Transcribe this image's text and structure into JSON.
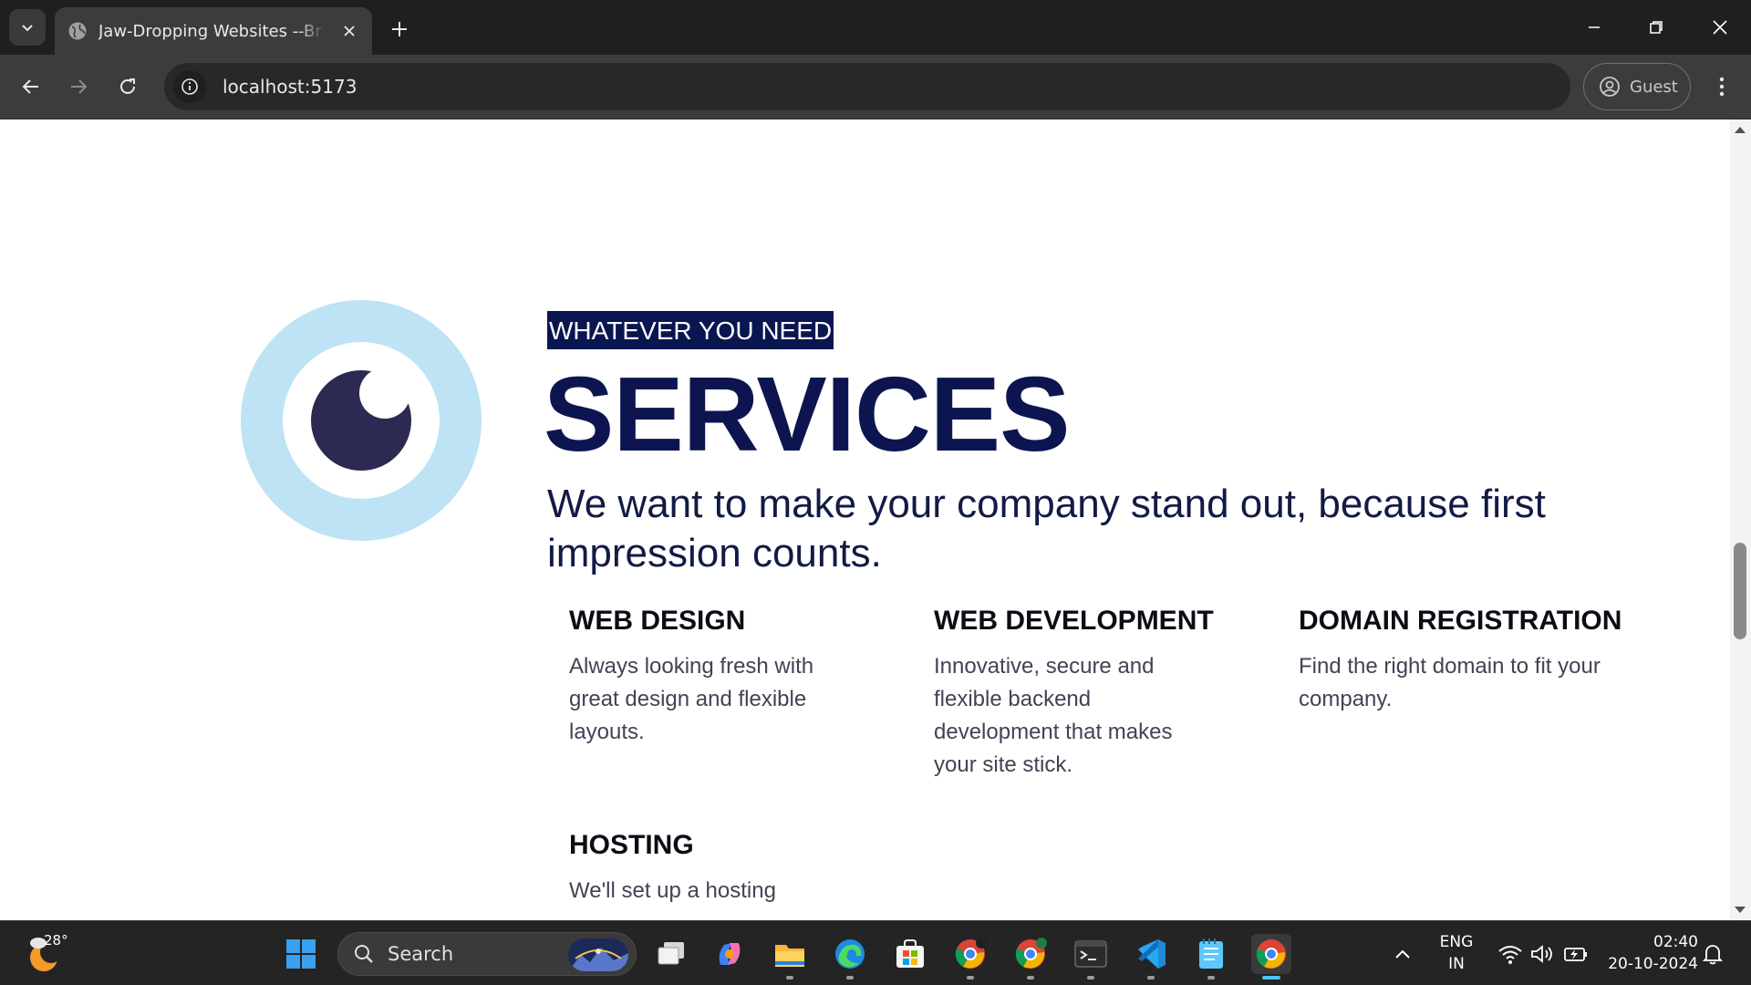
{
  "browser": {
    "tab": {
      "title": "Jaw-Dropping Websites --Brilwork"
    },
    "address": "localhost:5173",
    "profile": "Guest"
  },
  "page": {
    "eyebrow": "WHATEVER YOU NEED",
    "headline": "SERVICES",
    "tagline": "We want to make your company stand out, because first impression counts.",
    "services": [
      {
        "title": "WEB DESIGN",
        "description": "Always looking fresh with great design and flexible layouts."
      },
      {
        "title": "WEB DEVELOPMENT",
        "description": "Innovative, secure and flexible backend development that makes your site stick."
      },
      {
        "title": "DOMAIN REGISTRATION",
        "description": "Find the right domain to fit your company."
      },
      {
        "title": "HOSTING",
        "description": "We'll set up a hosting"
      }
    ],
    "colors": {
      "navy": "#0d1550",
      "logo_ring": "#bde3f5",
      "logo_dot": "#2c2a52"
    }
  },
  "taskbar": {
    "weather_temp": "28°",
    "search_label": "Search",
    "language": "ENG",
    "region": "IN",
    "time": "02:40",
    "date": "20-10-2024"
  }
}
